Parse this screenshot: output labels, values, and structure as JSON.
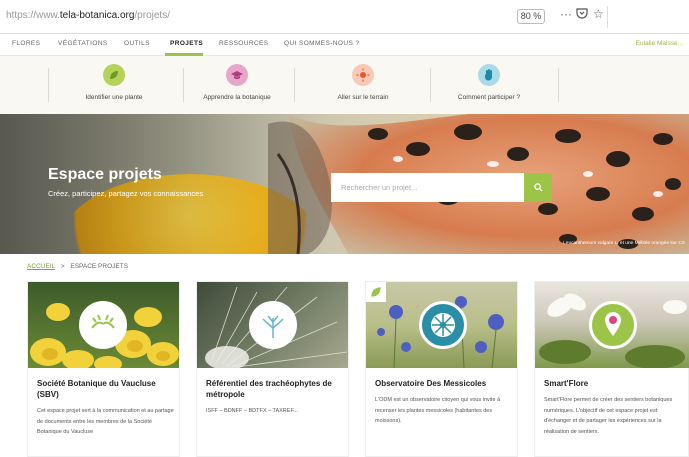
{
  "browser": {
    "url_prefix": "https://www.",
    "url_domain": "tela-botanica.org",
    "url_path": "/projets/",
    "zoom": "80 %",
    "icons": [
      "more-icon",
      "pocket-icon",
      "bookmark-star-icon"
    ]
  },
  "topnav": {
    "items": [
      "FLORES",
      "VÉGÉTATIONS",
      "OUTILS",
      "PROJETS",
      "RESSOURCES",
      "QUI SOMMES-NOUS ?"
    ],
    "active": "PROJETS",
    "right_link": "Eulalie Malsse..."
  },
  "subnav": [
    {
      "label": "Identifier une plante",
      "icon": "leaf-icon",
      "color": "#b5d35a"
    },
    {
      "label": "Apprendre la botanique",
      "icon": "graduation-cap-icon",
      "color": "#d97fb1"
    },
    {
      "label": "Aller sur le terrain",
      "icon": "sun-icon",
      "color": "#f2a07c"
    },
    {
      "label": "Comment participer ?",
      "icon": "hand-icon",
      "color": "#6ec1d6"
    }
  ],
  "hero": {
    "title": "Espace projets",
    "subtitle": "Créez, participez, partagez vos connaissances",
    "search_placeholder": "Rechercher un projet...",
    "search_button_icon": "search-icon",
    "credit": "Leucanthemum vulgare L. et une Mélitée orangée sur CS"
  },
  "breadcrumb": {
    "home": "ACCUEIL",
    "separator": ">",
    "current": "ESPACE PROJETS"
  },
  "cards": [
    {
      "title": "Société Botanique du Vaucluse (SBV)",
      "description": "Cet espace projet sert à la communication et au partage de documents entre les membres de la Société Botanique du Vaucluse",
      "badge_color": "#9bc449"
    },
    {
      "title": "Référentiel des trachéophytes de métropole",
      "description": "ISFF – BDNFF – BDTFX – TAXREF...",
      "badge_color": "#63b9c6"
    },
    {
      "title": "Observatoire Des Messicoles",
      "description": "L'ODM est un observatoire citoyen qui vous invite à recenser les plantes messicoles (habitantes des moissons).",
      "badge_color": "#2a8fa6"
    },
    {
      "title": "Smart'Flore",
      "description": "Smart'Flore permet de créer des sentiers botaniques numériques. L'objectif de cet espace projet est d'échanger et de partager les expériences sur la réalisation de sentiers.",
      "badge_color": "#9bc449"
    }
  ]
}
